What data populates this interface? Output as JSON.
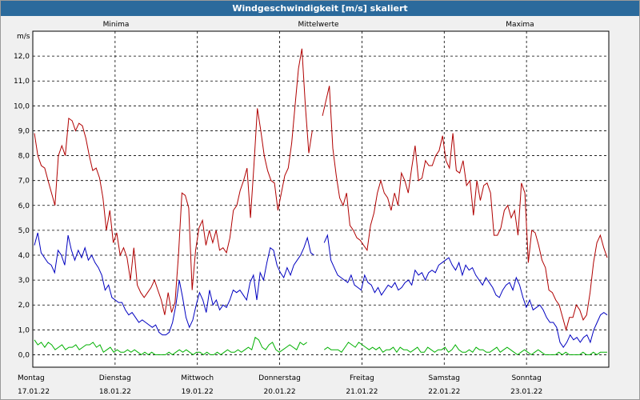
{
  "window_title": "Windgeschwindigkeit [m/s] skaliert",
  "chart_data": {
    "type": "line",
    "title": "Windgeschwindigkeit [m/s] skaliert",
    "ylabel": "m/s",
    "ylim": [
      -0.5,
      13
    ],
    "yticks": [
      "0,0",
      "1,0",
      "2,0",
      "3,0",
      "4,0",
      "5,0",
      "6,0",
      "7,0",
      "8,0",
      "9,0",
      "10,0",
      "11,0",
      "12,0"
    ],
    "grid": true,
    "legend_position": "top",
    "days": [
      {
        "name": "Montag",
        "date": "17.01.22"
      },
      {
        "name": "Dienstag",
        "date": "18.01.22"
      },
      {
        "name": "Mittwoch",
        "date": "19.01.22"
      },
      {
        "name": "Donnerstag",
        "date": "20.01.22"
      },
      {
        "name": "Freitag",
        "date": "21.01.22"
      },
      {
        "name": "Samstag",
        "date": "22.01.22"
      },
      {
        "name": "Sonntag",
        "date": "23.01.22"
      }
    ],
    "series": [
      {
        "name": "Minima",
        "color": "#00b000",
        "values": [
          0.6,
          0.4,
          0.5,
          0.3,
          0.5,
          0.4,
          0.2,
          0.3,
          0.4,
          0.2,
          0.3,
          0.3,
          0.4,
          0.2,
          0.3,
          0.4,
          0.4,
          0.5,
          0.3,
          0.4,
          0.1,
          0.2,
          0.3,
          0.1,
          0.2,
          0.1,
          0.1,
          0.2,
          0.1,
          0.2,
          0.1,
          0.0,
          0.1,
          0.0,
          0.1,
          0.0,
          0.0,
          0.0,
          0.0,
          0.1,
          0.0,
          0.1,
          0.2,
          0.1,
          0.2,
          0.1,
          0.0,
          0.1,
          0.1,
          0.0,
          0.1,
          0.0,
          0.0,
          0.1,
          0.0,
          0.1,
          0.2,
          0.1,
          0.1,
          0.2,
          0.1,
          0.2,
          0.3,
          0.2,
          0.7,
          0.6,
          0.3,
          0.2,
          0.4,
          0.5,
          0.2,
          0.1,
          0.2,
          0.3,
          0.4,
          0.3,
          0.2,
          0.5,
          0.4,
          0.5,
          null,
          null,
          null,
          null,
          0.2,
          0.3,
          0.2,
          0.2,
          0.2,
          0.1,
          0.3,
          0.5,
          0.4,
          0.3,
          0.5,
          0.4,
          0.3,
          0.2,
          0.3,
          0.2,
          0.3,
          0.1,
          0.2,
          0.2,
          0.3,
          0.1,
          0.3,
          0.2,
          0.2,
          0.1,
          0.2,
          0.3,
          0.1,
          0.1,
          0.3,
          0.2,
          0.1,
          0.2,
          0.2,
          0.3,
          0.1,
          0.2,
          0.4,
          0.2,
          0.1,
          0.1,
          0.2,
          0.1,
          0.3,
          0.2,
          0.2,
          0.1,
          0.1,
          0.2,
          0.3,
          0.1,
          0.2,
          0.3,
          0.2,
          0.1,
          0.0,
          0.1,
          0.2,
          0.1,
          0.0,
          0.1,
          0.2,
          0.1,
          0.0,
          0.0,
          0.0,
          0.0,
          0.1,
          0.0,
          0.1,
          0.0,
          0.0,
          0.0,
          0.0,
          0.1,
          0.0,
          0.0,
          0.1,
          0.0,
          0.1,
          0.1,
          0.1
        ]
      },
      {
        "name": "Mittelwerte",
        "color": "#0000c0",
        "values": [
          4.4,
          4.9,
          4.1,
          3.9,
          3.7,
          3.6,
          3.3,
          4.2,
          4.0,
          3.6,
          4.8,
          4.2,
          3.8,
          4.2,
          3.9,
          4.3,
          3.8,
          4.0,
          3.7,
          3.5,
          3.2,
          2.6,
          2.8,
          2.3,
          2.2,
          2.1,
          2.1,
          1.8,
          1.6,
          1.7,
          1.5,
          1.3,
          1.4,
          1.3,
          1.2,
          1.1,
          1.2,
          0.9,
          0.8,
          0.8,
          0.9,
          1.3,
          2.0,
          3.0,
          2.3,
          1.5,
          1.1,
          1.4,
          2.0,
          2.5,
          2.2,
          1.7,
          2.6,
          2.0,
          2.2,
          1.8,
          2.0,
          1.9,
          2.2,
          2.6,
          2.5,
          2.6,
          2.4,
          2.2,
          2.9,
          3.2,
          2.2,
          3.3,
          3.0,
          3.7,
          4.3,
          4.2,
          3.6,
          3.3,
          3.1,
          3.5,
          3.2,
          3.6,
          3.8,
          4.0,
          4.3,
          4.7,
          4.1,
          4.0,
          null,
          null,
          4.5,
          4.8,
          3.8,
          3.5,
          3.2,
          3.1,
          3.0,
          2.9,
          3.2,
          2.8,
          2.7,
          2.6,
          3.2,
          2.9,
          2.8,
          2.5,
          2.7,
          2.4,
          2.6,
          2.8,
          2.7,
          2.9,
          2.6,
          2.7,
          2.9,
          3.0,
          2.8,
          3.4,
          3.2,
          3.3,
          3.0,
          3.3,
          3.4,
          3.3,
          3.6,
          3.7,
          3.8,
          3.9,
          3.6,
          3.4,
          3.7,
          3.2,
          3.6,
          3.4,
          3.5,
          3.2,
          3.0,
          2.8,
          3.1,
          2.9,
          2.7,
          2.4,
          2.3,
          2.6,
          2.8,
          2.9,
          2.6,
          3.1,
          2.8,
          2.3,
          1.9,
          2.2,
          1.8,
          1.9,
          2.0,
          1.8,
          1.5,
          1.3,
          1.3,
          1.1,
          0.5,
          0.3,
          0.5,
          0.8,
          0.6,
          0.7,
          0.5,
          0.7,
          0.8,
          0.5,
          1.0,
          1.3,
          1.6,
          1.7,
          1.6
        ]
      },
      {
        "name": "Maxima",
        "color": "#b00000",
        "values": [
          8.9,
          8.0,
          7.6,
          7.5,
          7.0,
          6.5,
          6.0,
          8.0,
          8.4,
          8.0,
          9.5,
          9.4,
          9.0,
          9.3,
          9.2,
          8.7,
          8.0,
          7.4,
          7.5,
          7.1,
          6.3,
          5.0,
          5.8,
          4.5,
          4.9,
          4.0,
          4.3,
          3.9,
          3.0,
          4.3,
          2.8,
          2.5,
          2.3,
          2.5,
          2.7,
          3.0,
          2.6,
          2.2,
          1.6,
          2.5,
          1.7,
          2.1,
          4.0,
          6.5,
          6.4,
          5.9,
          2.6,
          4.2,
          5.1,
          5.4,
          4.4,
          5.0,
          4.5,
          5.0,
          4.2,
          4.3,
          4.1,
          4.7,
          5.8,
          6.0,
          6.6,
          7.0,
          7.5,
          5.5,
          7.6,
          9.9,
          9.0,
          8.0,
          7.4,
          7.0,
          6.9,
          5.8,
          6.5,
          7.2,
          7.5,
          8.5,
          10.0,
          11.5,
          12.3,
          10.0,
          8.1,
          9.0,
          null,
          null,
          9.6,
          10.2,
          10.8,
          8.3,
          7.2,
          6.3,
          6.0,
          6.5,
          5.2,
          5.0,
          4.7,
          4.6,
          4.4,
          4.2,
          5.2,
          5.7,
          6.5,
          7.0,
          6.5,
          6.3,
          5.8,
          6.5,
          6.0,
          7.3,
          7.0,
          6.5,
          7.5,
          8.4,
          7.0,
          7.1,
          7.8,
          7.6,
          7.6,
          8.0,
          8.2,
          8.8,
          7.8,
          7.5,
          8.9,
          7.4,
          7.3,
          7.8,
          6.8,
          7.0,
          5.6,
          7.0,
          6.2,
          6.8,
          6.9,
          6.5,
          4.8,
          4.8,
          5.1,
          5.8,
          6.0,
          5.5,
          5.8,
          4.8,
          6.9,
          6.5,
          3.7,
          5.0,
          4.9,
          4.4,
          3.8,
          3.5,
          2.6,
          2.5,
          2.2,
          2.0,
          1.5,
          1.0,
          1.5,
          1.5,
          2.0,
          1.8,
          1.4,
          1.6,
          2.5,
          3.7,
          4.5,
          4.8,
          4.3,
          3.9
        ]
      }
    ]
  }
}
